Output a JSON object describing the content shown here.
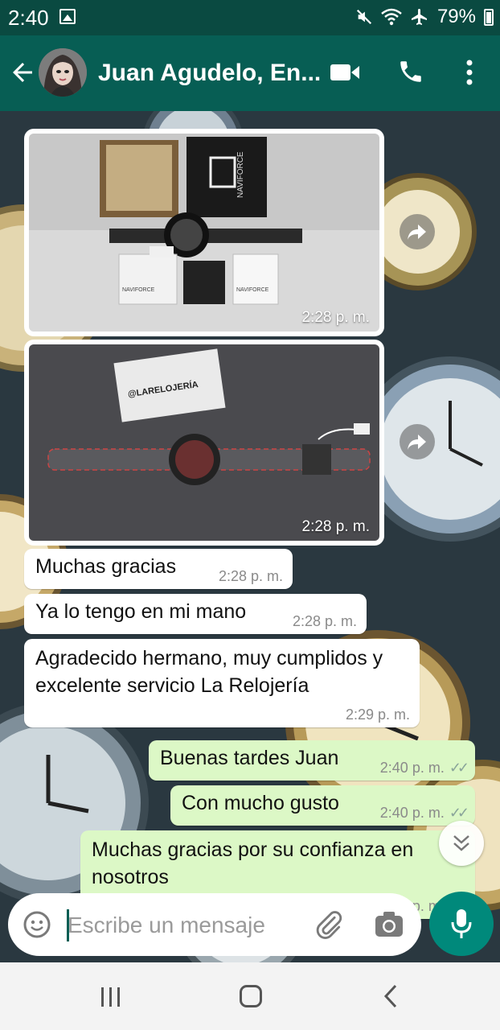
{
  "status_bar": {
    "time": "2:40",
    "battery": "79%"
  },
  "header": {
    "contact_name": "Juan Agudelo, En..."
  },
  "messages": [
    {
      "type": "image",
      "time": "2:28 p. m.",
      "direction": "incoming",
      "photo_labels": [
        "NAVIFORCE",
        "NAVIFORCE",
        "NAVIFORCE"
      ]
    },
    {
      "type": "image",
      "time": "2:28 p. m.",
      "direction": "incoming",
      "photo_labels": [
        "@LARELOJERÍA"
      ]
    },
    {
      "type": "text",
      "direction": "incoming",
      "text": "Muchas gracias",
      "time": "2:28 p. m."
    },
    {
      "type": "text",
      "direction": "incoming",
      "text": "Ya lo tengo en mi mano",
      "time": "2:28 p. m."
    },
    {
      "type": "text",
      "direction": "incoming",
      "text": "Agradecido hermano, muy cumplidos y excelente servicio La Relojería",
      "time": "2:29 p. m."
    },
    {
      "type": "text",
      "direction": "outgoing",
      "text": "Buenas tardes Juan",
      "time": "2:40 p. m."
    },
    {
      "type": "text",
      "direction": "outgoing",
      "text": "Con mucho gusto",
      "time": "2:40 p. m."
    },
    {
      "type": "text",
      "direction": "outgoing",
      "text": "Muchas gracias por su confianza en nosotros",
      "time": "2:40 p. m."
    }
  ],
  "composer": {
    "placeholder": "Escribe un mensaje"
  },
  "colors": {
    "header": "#075e54",
    "status_bar": "#0a4a41",
    "outgoing_bubble": "#dcf8c6",
    "incoming_bubble": "#ffffff",
    "mic_button": "#00897b"
  },
  "icons": [
    "back-arrow-icon",
    "video-call-icon",
    "phone-icon",
    "more-vert-icon",
    "forward-icon",
    "scroll-down-icon",
    "emoji-icon",
    "attach-icon",
    "camera-icon",
    "mic-icon",
    "recent-apps-icon",
    "home-icon",
    "nav-back-icon"
  ]
}
